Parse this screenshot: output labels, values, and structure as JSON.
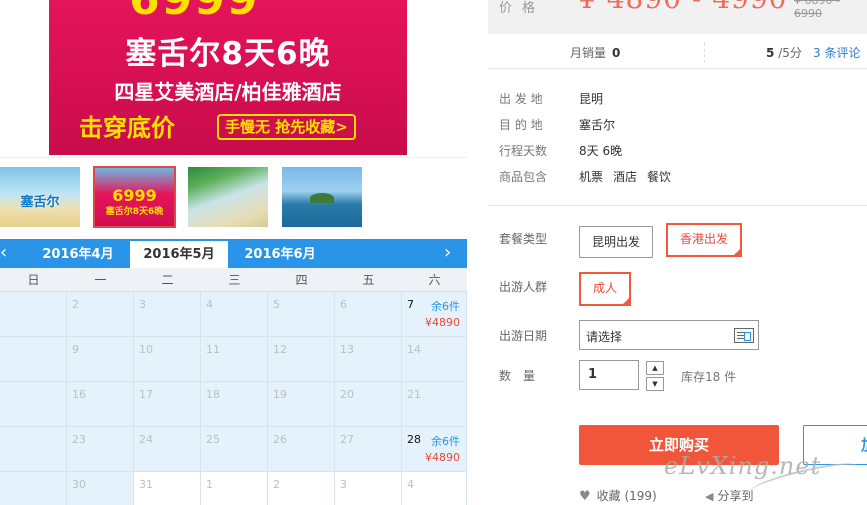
{
  "banner": {
    "price_partial": "6999",
    "title": "塞舌尔8天6晚",
    "hotels": "四星艾美酒店/柏佳雅酒店",
    "cta": "击穿底价",
    "cta_tag": "手慢无 抢先收藏>"
  },
  "thumbnails": [
    {
      "caption": "塞舌尔"
    },
    {
      "caption": "6999",
      "sub": "塞舌尔8天6晚"
    },
    {
      "caption": ""
    },
    {
      "caption": ""
    }
  ],
  "calendar": {
    "prev_icon": "‹",
    "next_icon": "›",
    "months": [
      "2016年4月",
      "2016年5月",
      "2016年6月"
    ],
    "weekdays": [
      "日",
      "一",
      "二",
      "三",
      "四",
      "五",
      "六"
    ],
    "rows": [
      [
        "",
        "2",
        "3",
        "4",
        "5",
        "6",
        "7"
      ],
      [
        "",
        "9",
        "10",
        "11",
        "12",
        "13",
        "14"
      ],
      [
        "",
        "16",
        "17",
        "18",
        "19",
        "20",
        "21"
      ],
      [
        "",
        "23",
        "24",
        "25",
        "26",
        "27",
        "28"
      ],
      [
        "",
        "30",
        "31",
        "1",
        "2",
        "3",
        "4"
      ]
    ],
    "available": [
      {
        "row": 0,
        "col": 6,
        "stock": "余6件",
        "price": "¥4890"
      },
      {
        "row": 3,
        "col": 6,
        "stock": "余6件",
        "price": "¥4890"
      }
    ]
  },
  "product": {
    "price_label": "价格",
    "price_value": "¥ 4890 - 4990",
    "price_original": "¥ 6890 - 6990",
    "monthly_sales_label": "月销量",
    "monthly_sales": "0",
    "score": "5",
    "score_suffix": "/5分",
    "reviews": "3 条评论",
    "info": [
      {
        "key": "出 发 地",
        "values": [
          "昆明"
        ]
      },
      {
        "key": "目 的 地",
        "values": [
          "塞舌尔"
        ]
      },
      {
        "key": "行程天数",
        "values": [
          "8天 6晚"
        ]
      },
      {
        "key": "商品包含",
        "values": [
          "机票",
          "酒店",
          "餐饮"
        ]
      }
    ]
  },
  "options": {
    "package_label": "套餐类型",
    "packages": [
      "昆明出发",
      "香港出发"
    ],
    "package_selected": "香港出发",
    "crowd_label": "出游人群",
    "crowd": [
      "成人"
    ],
    "crowd_selected": "成人",
    "date_label": "出游日期",
    "date_placeholder": "请选择",
    "qty_label": "数　量",
    "qty_value": "1",
    "qty_up": "▲",
    "qty_down": "▼",
    "stock_text": "库存18 件"
  },
  "actions": {
    "buy": "立即购买",
    "cart": "加",
    "favorite": "收藏 (199)",
    "share": "分享到"
  },
  "watermark": "eLvXing.net",
  "colors": {
    "accent": "#2a95e8",
    "price": "#f16a5c",
    "buy": "#f2563a",
    "selected_border": "#f05a3c"
  }
}
